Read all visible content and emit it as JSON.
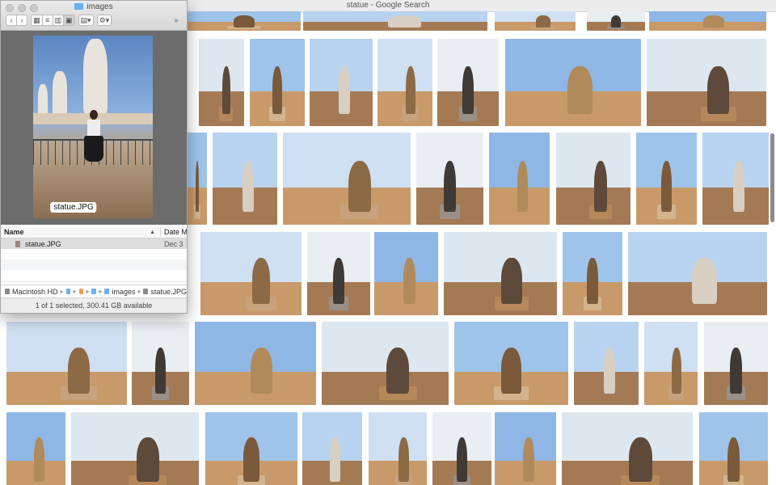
{
  "browser": {
    "window_title": "statue - Google Search"
  },
  "finder": {
    "title": "images",
    "preview": {
      "filename_label": "statue.JPG"
    },
    "columns": {
      "name": "Name",
      "date": "Date M"
    },
    "files": [
      {
        "name": "statue.JPG",
        "date": "Dec 3"
      }
    ],
    "path": [
      "Macintosh HD",
      "",
      "",
      "",
      "images",
      "statue.JPG"
    ],
    "status": "1 of 1 selected, 300.41 GB available"
  },
  "icons": {
    "back": "chevron-left-icon",
    "forward": "chevron-right-icon",
    "view_icon": "grid-view-icon",
    "view_list": "list-view-icon",
    "view_column": "column-view-icon",
    "view_gallery": "gallery-view-icon",
    "arrange": "arrange-icon",
    "action": "gear-icon",
    "more": "double-chevron-icon"
  },
  "colors": {
    "finder_preview_bg": "#6c6c6c",
    "folder_blue": "#6ab0f0",
    "selection_gray": "#dcdcdc"
  }
}
